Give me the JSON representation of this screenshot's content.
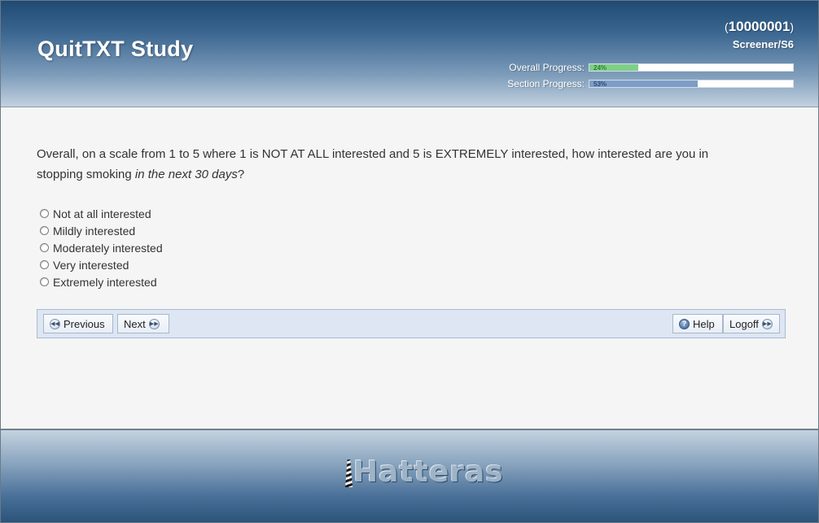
{
  "header": {
    "title": "QuitTXT Study",
    "participant_id": "10000001",
    "participant_open": "(",
    "participant_close": ")",
    "location": "Screener/S6",
    "overall_label": "Overall Progress:",
    "overall_pct_text": "24%",
    "overall_value": 24,
    "section_label": "Section Progress:",
    "section_pct_text": "53%",
    "section_value": 53
  },
  "question": {
    "text_main": "Overall, on a scale from 1 to 5 where 1 is NOT AT ALL interested and 5 is EXTREMELY interested, how interested are you in stopping smoking ",
    "text_emphasis": "in the next 30 days",
    "text_end": "?"
  },
  "answers": [
    {
      "label": "Not at all interested",
      "selected": false
    },
    {
      "label": "Mildly interested",
      "selected": false
    },
    {
      "label": "Moderately interested",
      "selected": false
    },
    {
      "label": "Very interested",
      "selected": false
    },
    {
      "label": "Extremely interested",
      "selected": false
    }
  ],
  "nav": {
    "previous_label": "Previous",
    "next_label": "Next",
    "help_label": "Help",
    "logoff_label": "Logoff"
  },
  "footer": {
    "logo_text": "Hatteras"
  },
  "colors": {
    "overall_fill": "#7fcf8a",
    "section_fill": "#7d9dc7",
    "header_dark": "#1f4a72"
  },
  "icons": {
    "previous": "rewind-circle-icon",
    "next": "fast-forward-circle-icon",
    "help": "question-circle-icon",
    "logoff": "fast-forward-circle-icon",
    "logo": "lighthouse-icon"
  }
}
